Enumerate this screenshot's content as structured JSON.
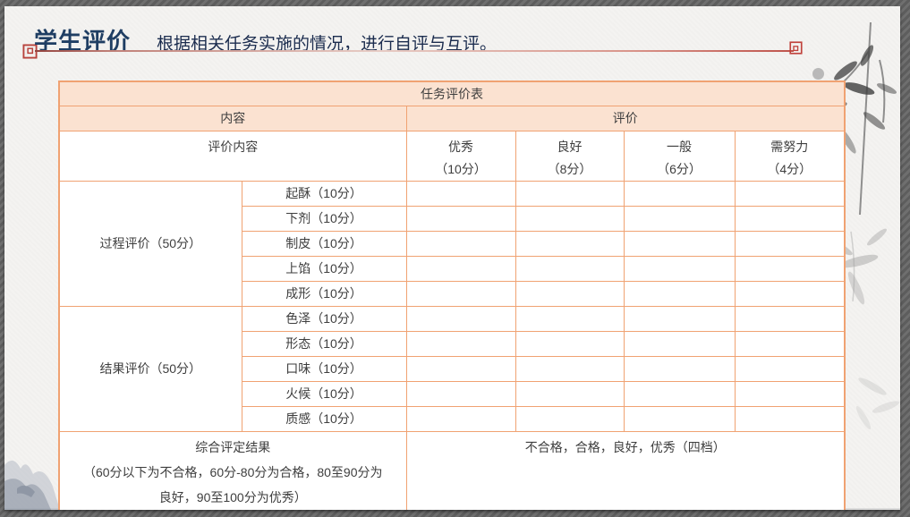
{
  "slide": {
    "title": "学生评价",
    "subtitle": "根据相关任务实施的情况，进行自评与互评。"
  },
  "table": {
    "caption": "任务评价表",
    "header": {
      "content": "内容",
      "evaluation": "评价",
      "sub_label": "评价内容",
      "grades": [
        {
          "name": "优秀",
          "score": "（10分）"
        },
        {
          "name": "良好",
          "score": "（8分）"
        },
        {
          "name": "一般",
          "score": "（6分）"
        },
        {
          "name": "需努力",
          "score": "（4分）"
        }
      ]
    },
    "sections": [
      {
        "title": "过程评价（50分）",
        "items": [
          "起酥（10分）",
          "下剂（10分）",
          "制皮（10分）",
          "上馅（10分）",
          "成形（10分）"
        ]
      },
      {
        "title": "结果评价（50分）",
        "items": [
          "色泽（10分）",
          "形态（10分）",
          "口味（10分）",
          "火候（10分）",
          "质感（10分）"
        ]
      }
    ],
    "summary": {
      "title": "综合评定结果",
      "note_line1": "（60分以下为不合格，60分-80分为合格，80至90分为",
      "note_line2": "良好，90至100分为优秀）",
      "result": "不合格，合格，良好，优秀（四档）"
    }
  },
  "colors": {
    "accent_border": "#F0A272",
    "header_fill": "#FBE2D1",
    "title_color": "#1F3E63",
    "ornament_red": "#C0423C"
  }
}
